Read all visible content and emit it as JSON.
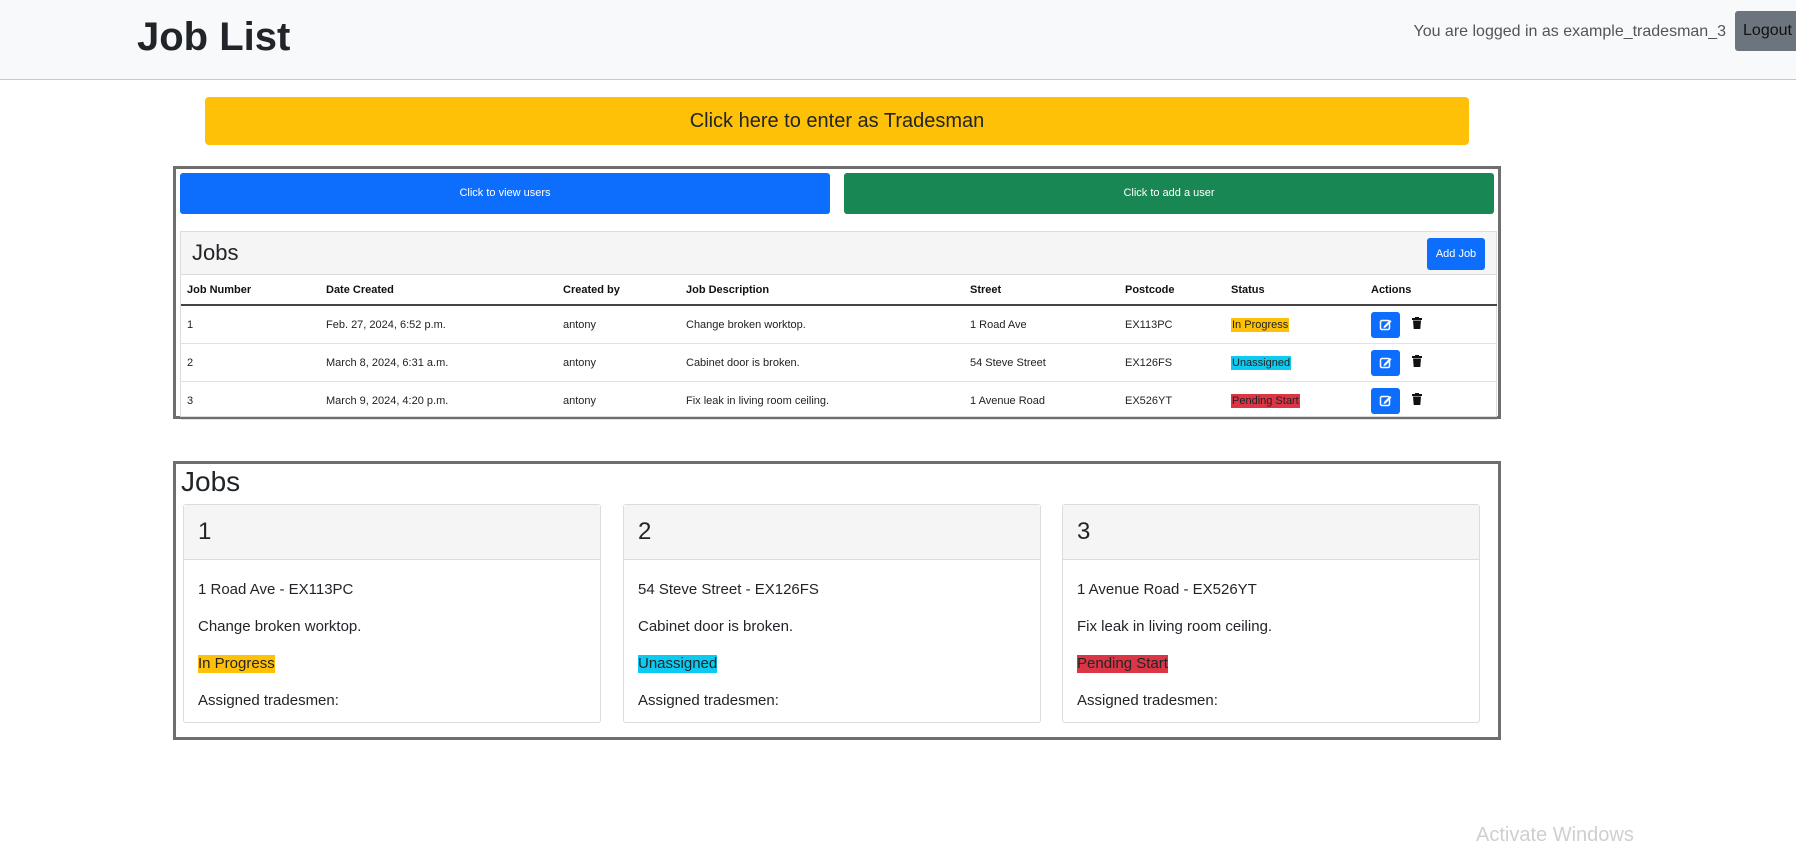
{
  "header": {
    "title": "Job List",
    "login_text": "You are logged in as example_tradesman_3",
    "logout_label": "Logout"
  },
  "tradesman_button": "Click here to enter as Tradesman",
  "admin_buttons": {
    "view_users": "Click to view users",
    "add_user": "Click to add a user"
  },
  "jobs_table_card": {
    "title": "Jobs",
    "add_job_label": "Add Job",
    "columns": [
      "Job Number",
      "Date Created",
      "Created by",
      "Job Description",
      "Street",
      "Postcode",
      "Status",
      "Actions"
    ],
    "rows": [
      {
        "number": "1",
        "date": "Feb. 27, 2024, 6:52 p.m.",
        "created_by": "antony",
        "description": "Change broken worktop.",
        "street": "1 Road Ave",
        "postcode": "EX113PC",
        "status": "In Progress",
        "status_color": "#ffc107"
      },
      {
        "number": "2",
        "date": "March 8, 2024, 6:31 a.m.",
        "created_by": "antony",
        "description": "Cabinet door is broken.",
        "street": "54 Steve Street",
        "postcode": "EX126FS",
        "status": "Unassigned",
        "status_color": "#0dcaf0"
      },
      {
        "number": "3",
        "date": "March 9, 2024, 4:20 p.m.",
        "created_by": "antony",
        "description": "Fix leak in living room ceiling.",
        "street": "1 Avenue Road",
        "postcode": "EX526YT",
        "status": "Pending Start",
        "status_color": "#dc3545"
      }
    ],
    "action_icons": [
      "edit-icon",
      "trash-icon"
    ]
  },
  "jobs_cards_section": {
    "title": "Jobs",
    "cards": [
      {
        "number": "1",
        "address": "1 Road Ave - EX113PC",
        "description": "Change broken worktop.",
        "status": "In Progress",
        "assigned_label": "Assigned tradesmen:"
      },
      {
        "number": "2",
        "address": "54 Steve Street - EX126FS",
        "description": "Cabinet door is broken.",
        "status": "Unassigned",
        "assigned_label": "Assigned tradesmen:"
      },
      {
        "number": "3",
        "address": "1 Avenue Road - EX526YT",
        "description": "Fix leak in living room ceiling.",
        "status": "Pending Start",
        "assigned_label": "Assigned tradesmen:"
      }
    ]
  },
  "watermark": "Activate Windows",
  "colors": {
    "primary": "#0d6efd",
    "success": "#198754",
    "warning": "#ffc107",
    "info": "#0dcaf0",
    "danger": "#dc3545",
    "secondary": "#6c757d"
  }
}
